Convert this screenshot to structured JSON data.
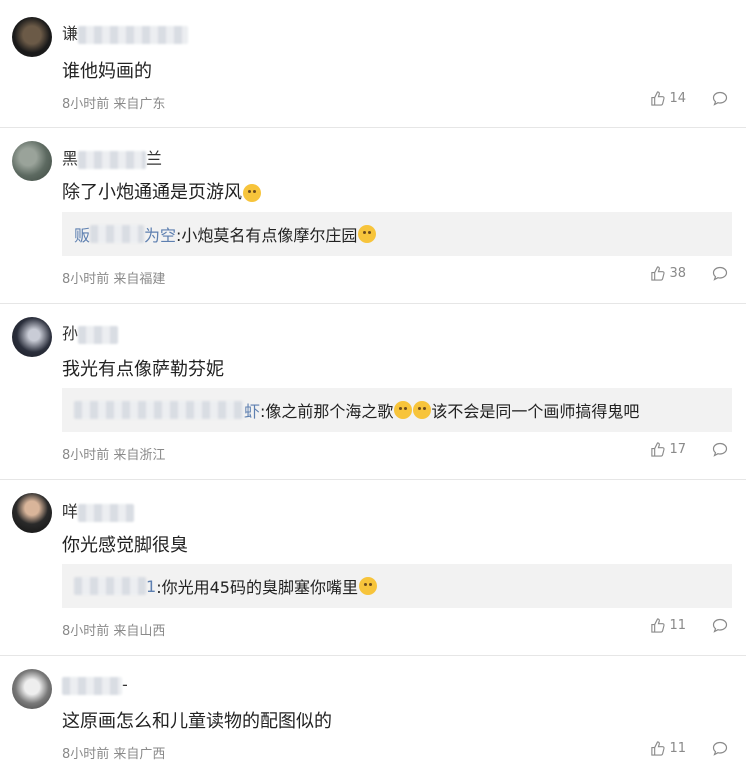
{
  "comments": [
    {
      "name_prefix": "谦",
      "name_suffix": "",
      "text": "谁他妈画的",
      "reply": null,
      "time": "8小时前",
      "source": "来自广东",
      "likes": "14"
    },
    {
      "name_prefix": "黑",
      "name_suffix": "兰",
      "text": "除了小炮通通是页游风",
      "reply": {
        "name_prefix": "贩",
        "name_suffix": "为空",
        "text": ":小炮莫名有点像摩尔庄园"
      },
      "time": "8小时前",
      "source": "来自福建",
      "likes": "38"
    },
    {
      "name_prefix": "孙",
      "name_suffix": "",
      "text": "我光有点像萨勒芬妮",
      "reply": {
        "name_prefix": "",
        "name_suffix": "虾",
        "text": ":像之前那个海之歌",
        "text2": "该不会是同一个画师搞得鬼吧"
      },
      "time": "8小时前",
      "source": "来自浙江",
      "likes": "17"
    },
    {
      "name_prefix": "咩",
      "name_suffix": "",
      "text": "你光感觉脚很臭",
      "reply": {
        "name_prefix": "",
        "name_suffix": "1",
        "text": ":你光用45码的臭脚塞你嘴里"
      },
      "time": "8小时前",
      "source": "来自山西",
      "likes": "11"
    },
    {
      "name_prefix": "",
      "name_suffix": "-",
      "text": "这原画怎么和儿童读物的配图似的",
      "reply": null,
      "time": "8小时前",
      "source": "来自广西",
      "likes": "11"
    }
  ]
}
